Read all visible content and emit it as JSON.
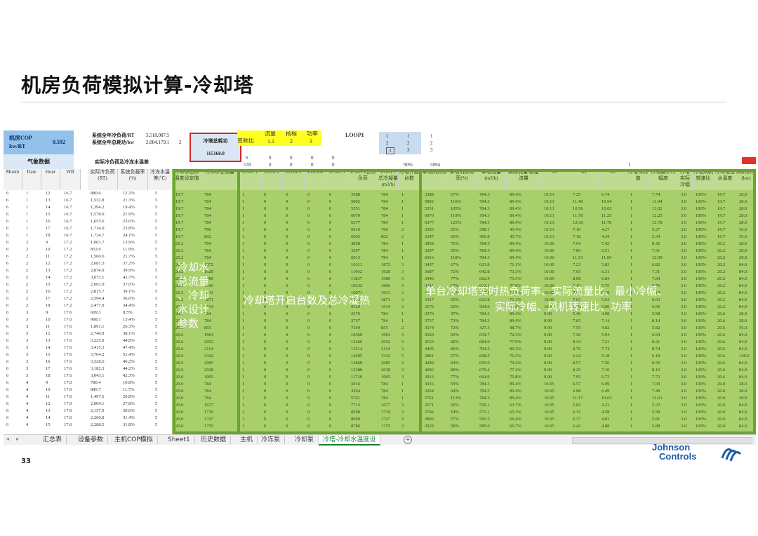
{
  "title": "机房负荷模拟计算-冷却塔",
  "page_number": "33",
  "logo": {
    "line1": "Johnson",
    "line2": "Controls"
  },
  "sheet": {
    "cop_label_1": "机房COP",
    "cop_label_2": "kw/RT",
    "cop_value": "0.592",
    "weather_label": "气象数据",
    "sys_load_label": "系统全年冷负荷/RT",
    "sys_load_value": "3,518,087.5",
    "sys_power_label": "系统全年总耗功/kw",
    "sys_power_value": "2,084,179.1",
    "side_number": "2",
    "actual_label": "实际冷负荷及冷冻水温差",
    "tower_power_label": "冷塔总耗功",
    "tower_power_value": "115168.0",
    "freq_label": "变频比",
    "flow_label": "流量",
    "head_label": "扬程",
    "power_label": "功率",
    "yellow_vals": [
      "1.1",
      "2",
      "3"
    ],
    "loop_label": "LOOP1",
    "loop_grid": [
      [
        "1",
        "1",
        "1"
      ],
      [
        "2",
        "2",
        "2"
      ],
      [
        "3",
        "3",
        "3"
      ]
    ],
    "row_vals_a": [
      "6",
      "0",
      "0",
      "0",
      "0"
    ],
    "row_vals_b": [
      "578",
      "0",
      "0",
      "0",
      "0"
    ],
    "pct_90": "90%",
    "val_5094": "5094",
    "val_1": "1"
  },
  "headers": {
    "month": "Month",
    "date": "Date",
    "hour": "Hour",
    "wb": "WB",
    "actual_load": "实际冷负荷(RT)",
    "load_rate": "系统负载率(%)",
    "chw_dt": "冷冻水温差(℃)",
    "cw_temp": "冷却水出水温度设定值",
    "cw_flow": "冷却水总流量",
    "loops": [
      "LOOP1",
      "LOOP2",
      "LOOP3",
      "LOOP4",
      "LOOP5"
    ],
    "loop_heat": "LOOP1总热负荷",
    "loop_cond": "LOOP1总冷凝量(m3/h)",
    "cts_on": "冷塔开启台数",
    "unit_heat": "单塔热负荷",
    "unit_rate": "单塔热负荷率(%)",
    "unit_flow": "单塔流量(m3/h)",
    "actual_flow": "实际流量/额定流量",
    "a1": "A1",
    "a2": "A2",
    "a3": "A3",
    "cooling_unit": "冷塔传热值",
    "min_range": "冷塔最小冷幅度",
    "actual_range": "冷塔实际冷幅",
    "fan_speed": "冷塔风机转速比",
    "out_temp": "冷却塔出水温度",
    "power": "风机功率(kw)"
  },
  "overlays": {
    "left": [
      "冷却水",
      "总流量",
      "、冷却",
      "水设计",
      "参数"
    ],
    "middle": "冷却塔开启台数及总冷凝热",
    "right_1": "单台冷却塔实时热负荷率、实际流量比、最小冷幅、",
    "right_2": "实际冷幅、风机转速比、功率"
  },
  "left_rows": [
    [
      "6",
      "1",
      "12",
      "16.7",
      "880.6",
      "12.2%",
      "5"
    ],
    [
      "6",
      "1",
      "13",
      "16.7",
      "1,532.8",
      "21.3%",
      "5"
    ],
    [
      "6",
      "1",
      "14",
      "16.7",
      "1,394.2",
      "19.4%",
      "5"
    ],
    [
      "6",
      "1",
      "15",
      "16.7",
      "1,578.0",
      "21.9%",
      "5"
    ],
    [
      "6",
      "1",
      "16",
      "16.7",
      "1,655.6",
      "23.0%",
      "5"
    ],
    [
      "6",
      "1",
      "17",
      "16.7",
      "1,714.0",
      "23.8%",
      "5"
    ],
    [
      "6",
      "1",
      "18",
      "16.7",
      "1,734.7",
      "24.1%",
      "5"
    ],
    [
      "6",
      "2",
      "9",
      "17.2",
      "1,001.7",
      "13.9%",
      "5"
    ],
    [
      "6",
      "2",
      "10",
      "17.2",
      "853.9",
      "11.9%",
      "5"
    ],
    [
      "6",
      "2",
      "11",
      "17.2",
      "1,560.6",
      "21.7%",
      "5"
    ],
    [
      "6",
      "2",
      "12",
      "17.2",
      "2,681.3",
      "37.2%",
      "5"
    ],
    [
      "6",
      "2",
      "13",
      "17.2",
      "2,874.9",
      "39.9%",
      "5"
    ],
    [
      "6",
      "2",
      "14",
      "17.2",
      "3,073.1",
      "42.7%",
      "5"
    ],
    [
      "6",
      "2",
      "15",
      "17.2",
      "2,661.0",
      "37.0%",
      "5"
    ],
    [
      "6",
      "2",
      "16",
      "17.2",
      "2,815.7",
      "39.1%",
      "5"
    ],
    [
      "6",
      "2",
      "17",
      "17.2",
      "2,594.4",
      "36.0%",
      "5"
    ],
    [
      "6",
      "2",
      "18",
      "17.2",
      "2,477.9",
      "34.4%",
      "5"
    ],
    [
      "6",
      "3",
      "9",
      "17.6",
      "609.3",
      "8.5%",
      "5"
    ],
    [
      "6",
      "3",
      "10",
      "17.6",
      "968.1",
      "13.4%",
      "5"
    ],
    [
      "6",
      "3",
      "11",
      "17.6",
      "1,891.1",
      "26.3%",
      "5"
    ],
    [
      "6",
      "3",
      "12",
      "17.6",
      "2,740.9",
      "38.1%",
      "5"
    ],
    [
      "6",
      "3",
      "13",
      "17.6",
      "3,225.9",
      "44.8%",
      "5"
    ],
    [
      "6",
      "3",
      "14",
      "17.6",
      "3,415.3",
      "47.4%",
      "5"
    ],
    [
      "6",
      "3",
      "15",
      "17.6",
      "3,704.2",
      "51.4%",
      "5"
    ],
    [
      "6",
      "3",
      "16",
      "17.6",
      "3,328.6",
      "46.2%",
      "5"
    ],
    [
      "6",
      "3",
      "17",
      "17.6",
      "3,182.3",
      "44.2%",
      "5"
    ],
    [
      "6",
      "3",
      "18",
      "17.6",
      "3,043.1",
      "42.3%",
      "5"
    ],
    [
      "6",
      "4",
      "9",
      "17.0",
      "780.4",
      "10.8%",
      "5"
    ],
    [
      "6",
      "4",
      "10",
      "17.0",
      "845.7",
      "11.7%",
      "5"
    ],
    [
      "6",
      "4",
      "11",
      "17.0",
      "1,497.6",
      "20.8%",
      "5"
    ],
    [
      "6",
      "4",
      "12",
      "17.0",
      "2,004.1",
      "27.8%",
      "5"
    ],
    [
      "6",
      "4",
      "13",
      "17.0",
      "2,157.9",
      "30.0%",
      "5"
    ],
    [
      "6",
      "4",
      "14",
      "17.0",
      "2,260.8",
      "31.4%",
      "5"
    ],
    [
      "6",
      "4",
      "15",
      "17.0",
      "2,288.5",
      "31.8%",
      "5"
    ]
  ],
  "green_rows": [
    [
      "19.7",
      "784",
      "1",
      "0",
      "0",
      "0",
      "0",
      "3388",
      "784",
      "1",
      "3388",
      "67%",
      "784.3",
      "89.4%",
      "10.13",
      "7.25",
      "6.74",
      "1",
      "7.74",
      "3.0",
      "100%",
      "19.7",
      "28.0"
    ],
    [
      "19.7",
      "784",
      "1",
      "0",
      "0",
      "0",
      "0",
      "5892",
      "784",
      "1",
      "5892",
      "116%",
      "784.3",
      "89.4%",
      "10.13",
      "11.48",
      "10.94",
      "1",
      "11.94",
      "3.0",
      "100%",
      "19.7",
      "28.0"
    ],
    [
      "19.7",
      "784",
      "1",
      "0",
      "0",
      "0",
      "0",
      "5351",
      "784",
      "1",
      "5351",
      "105%",
      "784.3",
      "89.4%",
      "10.13",
      "10.56",
      "10.02",
      "1",
      "11.02",
      "3.0",
      "100%",
      "19.7",
      "28.0"
    ],
    [
      "19.7",
      "784",
      "1",
      "0",
      "0",
      "0",
      "0",
      "6070",
      "784",
      "1",
      "6070",
      "119%",
      "784.3",
      "89.4%",
      "10.13",
      "11.78",
      "11.25",
      "1",
      "12.25",
      "3.0",
      "100%",
      "19.7",
      "28.0"
    ],
    [
      "19.7",
      "784",
      "1",
      "0",
      "0",
      "0",
      "0",
      "6377",
      "784",
      "1",
      "6377",
      "125%",
      "784.3",
      "89.4%",
      "10.13",
      "12.30",
      "11.78",
      "1",
      "12.78",
      "3.0",
      "100%",
      "19.7",
      "28.0"
    ],
    [
      "19.7",
      "796",
      "1",
      "0",
      "0",
      "0",
      "0",
      "6610",
      "796",
      "2",
      "3305",
      "65%",
      "398.1",
      "45.4%",
      "10.13",
      "7.10",
      "4.27",
      "1",
      "5.27",
      "3.0",
      "100%",
      "19.7",
      "56.0"
    ],
    [
      "19.7",
      "802",
      "1",
      "0",
      "0",
      "0",
      "0",
      "6693",
      "802",
      "2",
      "3347",
      "66%",
      "400.8",
      "45.7%",
      "10.13",
      "7.18",
      "4.34",
      "1",
      "5.34",
      "3.0",
      "100%",
      "19.7",
      "56.0"
    ],
    [
      "20.2",
      "784",
      "1",
      "0",
      "0",
      "0",
      "0",
      "3858",
      "784",
      "1",
      "3858",
      "76%",
      "784.3",
      "89.4%",
      "10.00",
      "7.94",
      "7.42",
      "1",
      "8.42",
      "3.0",
      "100%",
      "20.2",
      "28.0"
    ],
    [
      "20.2",
      "784",
      "1",
      "0",
      "0",
      "0",
      "0",
      "3297",
      "784",
      "1",
      "3297",
      "65%",
      "784.3",
      "89.4%",
      "10.00",
      "7.00",
      "6.51",
      "1",
      "7.51",
      "3.0",
      "100%",
      "20.2",
      "28.0"
    ],
    [
      "20.2",
      "784",
      "1",
      "0",
      "0",
      "0",
      "0",
      "6013",
      "784",
      "1",
      "6013",
      "118%",
      "784.3",
      "89.4%",
      "10.00",
      "11.53",
      "11.00",
      "1",
      "12.00",
      "3.0",
      "100%",
      "20.2",
      "28.0"
    ],
    [
      "20.2",
      "1872",
      "1",
      "0",
      "0",
      "0",
      "0",
      "10311",
      "1872",
      "3",
      "3437",
      "67%",
      "623.9",
      "71.1%",
      "10.00",
      "7.23",
      "5.82",
      "1",
      "6.82",
      "3.0",
      "100%",
      "20.2",
      "84.0"
    ],
    [
      "20.2",
      "1928",
      "1",
      "0",
      "0",
      "0",
      "0",
      "11062",
      "1928",
      "3",
      "3687",
      "72%",
      "642.8",
      "73.3%",
      "10.00",
      "7.65",
      "6.31",
      "1",
      "7.31",
      "3.0",
      "100%",
      "20.2",
      "84.0"
    ],
    [
      "20.2",
      "1989",
      "1",
      "0",
      "0",
      "0",
      "0",
      "11837",
      "1989",
      "3",
      "3946",
      "77%",
      "662.9",
      "75.5%",
      "10.00",
      "8.08",
      "6.84",
      "1",
      "7.84",
      "3.0",
      "100%",
      "20.2",
      "84.0"
    ],
    [
      "20.2",
      "1866",
      "1",
      "0",
      "0",
      "0",
      "0",
      "10232",
      "1866",
      "3",
      "3411",
      "67%",
      "622.1",
      "70.9%",
      "10.00",
      "7.19",
      "5.76",
      "1",
      "6.76",
      "3.0",
      "100%",
      "20.2",
      "84.0"
    ],
    [
      "20.2",
      "1911",
      "1",
      "0",
      "0",
      "0",
      "0",
      "10871",
      "1911",
      "3",
      "3624",
      "71%",
      "637.1",
      "72.6%",
      "10.00",
      "7.54",
      "6.18",
      "1",
      "7.18",
      "3.0",
      "100%",
      "20.2",
      "84.0"
    ],
    [
      "20.2",
      "1871",
      "1",
      "0",
      "0",
      "0",
      "0",
      "9950",
      "1871",
      "3",
      "3317",
      "65%",
      "623.8",
      "71.1%",
      "10.00",
      "7.03",
      "5.63",
      "1",
      "6.63",
      "3.0",
      "100%",
      "20.2",
      "84.0"
    ],
    [
      "20.2",
      "1514",
      "1",
      "0",
      "0",
      "0",
      "0",
      "9529",
      "1514",
      "3",
      "3176",
      "62%",
      "504.6",
      "57.5%",
      "10.00",
      "6.79",
      "5.06",
      "1",
      "6.06",
      "3.0",
      "100%",
      "20.2",
      "84.0"
    ],
    [
      "20.6",
      "784",
      "1",
      "0",
      "0",
      "0",
      "0",
      "2370",
      "784",
      "1",
      "2370",
      "47%",
      "784.3",
      "89.4%",
      "9.90",
      "5.46",
      "4.98",
      "1",
      "5.98",
      "3.0",
      "100%",
      "20.6",
      "28.0"
    ],
    [
      "20.6",
      "784",
      "1",
      "0",
      "0",
      "0",
      "0",
      "3737",
      "784",
      "1",
      "3737",
      "73%",
      "784.3",
      "89.4%",
      "9.90",
      "7.65",
      "7.14",
      "1",
      "8.14",
      "3.0",
      "100%",
      "20.6",
      "28.0"
    ],
    [
      "20.6",
      "855",
      "1",
      "0",
      "0",
      "0",
      "0",
      "7349",
      "855",
      "2",
      "3674",
      "72%",
      "427.3",
      "48.7%",
      "9.90",
      "7.55",
      "4.82",
      "1",
      "5.82",
      "3.0",
      "100%",
      "20.6",
      "56.0"
    ],
    [
      "20.6",
      "1904",
      "1",
      "0",
      "0",
      "0",
      "0",
      "10560",
      "1904",
      "3",
      "3520",
      "69%",
      "634.7",
      "72.3%",
      "9.90",
      "7.30",
      "5.94",
      "1",
      "6.94",
      "3.0",
      "100%",
      "20.6",
      "84.0"
    ],
    [
      "20.6",
      "2052",
      "1",
      "0",
      "0",
      "0",
      "0",
      "12460",
      "2052",
      "3",
      "4153",
      "82%",
      "684.0",
      "77.9%",
      "9.90",
      "8.34",
      "7.21",
      "1",
      "8.21",
      "3.0",
      "100%",
      "20.6",
      "84.0"
    ],
    [
      "20.6",
      "2114",
      "1",
      "0",
      "0",
      "0",
      "0",
      "13214",
      "2114",
      "3",
      "4405",
      "86%",
      "704.5",
      "80.3%",
      "9.90",
      "8.76",
      "7.74",
      "1",
      "8.74",
      "3.0",
      "100%",
      "20.6",
      "84.0"
    ],
    [
      "20.6",
      "3342",
      "1",
      "0",
      "0",
      "0",
      "0",
      "14405",
      "3342",
      "5",
      "2881",
      "57%",
      "668.5",
      "76.2%",
      "9.90",
      "6.24",
      "5.18",
      "1",
      "6.18",
      "3.0",
      "100%",
      "20.6",
      "140.0"
    ],
    [
      "20.6",
      "2085",
      "1",
      "0",
      "0",
      "0",
      "0",
      "12868",
      "2085",
      "3",
      "4289",
      "84%",
      "695.0",
      "79.2%",
      "9.90",
      "8.57",
      "7.50",
      "1",
      "8.50",
      "3.0",
      "100%",
      "20.6",
      "84.0"
    ],
    [
      "20.6",
      "2038",
      "1",
      "0",
      "0",
      "0",
      "0",
      "12288",
      "2038",
      "3",
      "4096",
      "80%",
      "679.4",
      "77.4%",
      "9.90",
      "8.25",
      "7.10",
      "1",
      "8.10",
      "3.0",
      "100%",
      "20.6",
      "84.0"
    ],
    [
      "20.6",
      "1995",
      "1",
      "0",
      "0",
      "0",
      "0",
      "11739",
      "1995",
      "3",
      "3913",
      "77%",
      "664.9",
      "75.8%",
      "9.90",
      "7.95",
      "6.72",
      "1",
      "7.72",
      "3.0",
      "100%",
      "20.6",
      "84.0"
    ],
    [
      "20.0",
      "784",
      "1",
      "0",
      "0",
      "0",
      "0",
      "3016",
      "784",
      "1",
      "3016",
      "59%",
      "784.3",
      "89.4%",
      "10.05",
      "6.57",
      "6.09",
      "1",
      "7.09",
      "3.0",
      "100%",
      "20.0",
      "28.0"
    ],
    [
      "20.0",
      "784",
      "1",
      "0",
      "0",
      "0",
      "0",
      "3264",
      "784",
      "1",
      "3264",
      "64%",
      "784.3",
      "89.4%",
      "10.05",
      "6.98",
      "6.49",
      "1",
      "7.49",
      "3.0",
      "100%",
      "20.0",
      "28.0"
    ],
    [
      "20.0",
      "784",
      "1",
      "0",
      "0",
      "0",
      "0",
      "5761",
      "784",
      "1",
      "5761",
      "113%",
      "784.3",
      "89.4%",
      "10.05",
      "11.17",
      "10.63",
      "1",
      "11.63",
      "3.0",
      "100%",
      "20.0",
      "28.0"
    ],
    [
      "20.0",
      "1677",
      "1",
      "0",
      "0",
      "0",
      "0",
      "7713",
      "1677",
      "3",
      "2571",
      "50%",
      "559.1",
      "63.7%",
      "10.05",
      "5.82",
      "4.23",
      "1",
      "5.23",
      "3.0",
      "100%",
      "20.0",
      "84.0"
    ],
    [
      "20.0",
      "1719",
      "1",
      "0",
      "0",
      "0",
      "0",
      "8298",
      "1719",
      "3",
      "2766",
      "54%",
      "573.1",
      "65.3%",
      "10.05",
      "6.15",
      "4.58",
      "1",
      "5.58",
      "3.0",
      "100%",
      "20.0",
      "84.0"
    ],
    [
      "20.0",
      "1747",
      "1",
      "0",
      "0",
      "0",
      "0",
      "8689",
      "1747",
      "3",
      "2896",
      "57%",
      "582.5",
      "66.4%",
      "10.05",
      "6.37",
      "4.81",
      "1",
      "5.81",
      "3.0",
      "100%",
      "20.0",
      "84.0"
    ],
    [
      "20.0",
      "1755",
      "1",
      "0",
      "0",
      "0",
      "0",
      "8786",
      "1755",
      "3",
      "2929",
      "58%",
      "585.0",
      "66.7%",
      "10.05",
      "6.43",
      "4.88",
      "1",
      "5.88",
      "3.0",
      "100%",
      "20.0",
      "84.0"
    ]
  ],
  "tabs": [
    "汇总表",
    "设备参数",
    "主机COP模拟",
    "Sheet1",
    "历史数据",
    "主机",
    "冷冻泵",
    "冷却泵",
    "冷塔-冷却水温度设"
  ],
  "active_tab_index": 8,
  "colors": {
    "green_fill": "#a8cf6a",
    "green_border": "#6aa62f",
    "yellow": "#ffff22",
    "cop_blue": "#93c1ea",
    "red": "#d32626",
    "logo_blue": "#1a5aa6"
  }
}
